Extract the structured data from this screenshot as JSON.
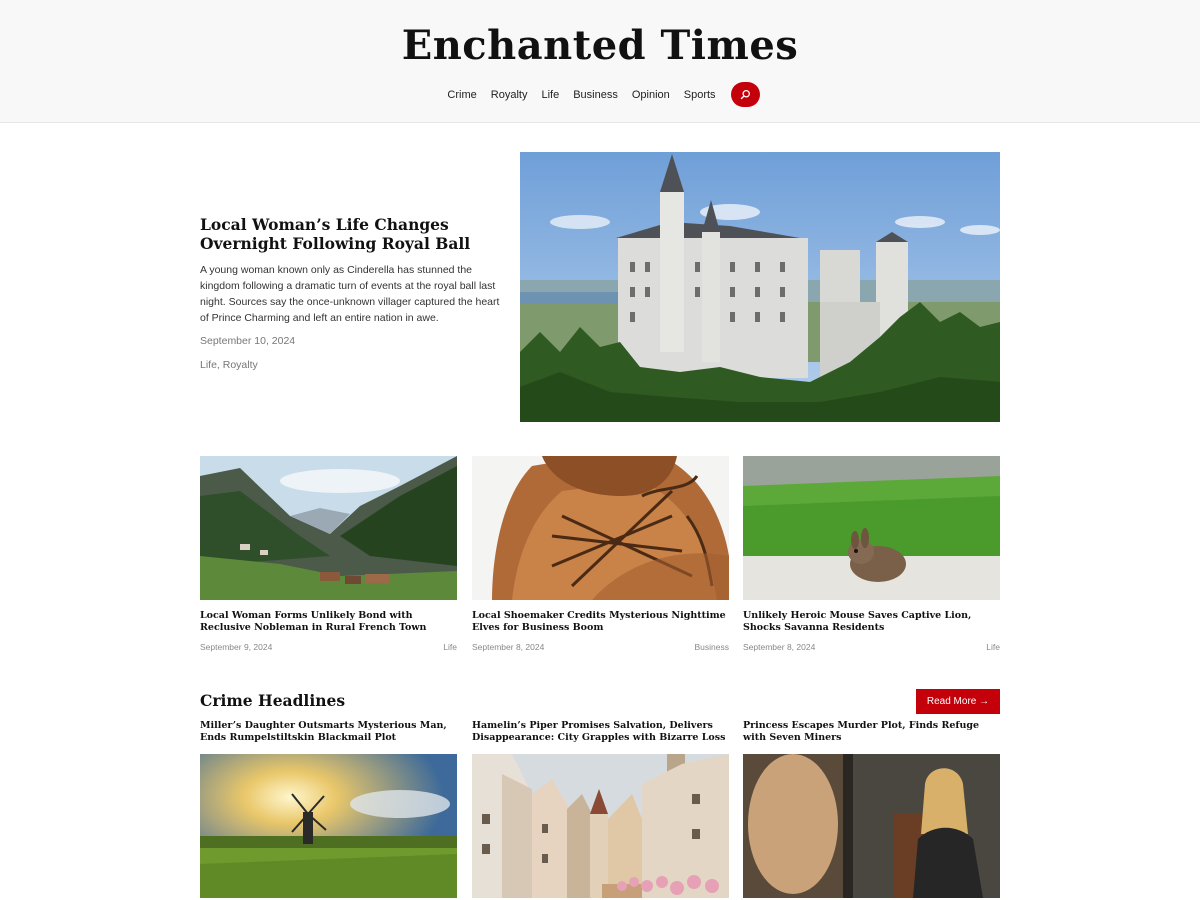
{
  "site": {
    "title": "Enchanted Times"
  },
  "nav": {
    "items": [
      "Crime",
      "Royalty",
      "Life",
      "Business",
      "Opinion",
      "Sports"
    ],
    "search_icon": "search-icon"
  },
  "hero": {
    "title": "Local Woman’s Life Changes Overnight Following Royal Ball",
    "excerpt": "A young woman known only as Cinderella has stunned the kingdom following a dramatic turn of events at the royal ball last night. Sources say the once-unknown villager captured the heart of Prince Charming and left an entire nation in awe.",
    "date": "September 10, 2024",
    "categories": "Life, Royalty"
  },
  "cards": [
    {
      "title": "Local Woman Forms Unlikely Bond with Reclusive Nobleman in Rural French Town",
      "date": "September 9, 2024",
      "category": "Life"
    },
    {
      "title": "Local Shoemaker Credits Mysterious Nighttime Elves for Business Boom",
      "date": "September 8, 2024",
      "category": "Business"
    },
    {
      "title": "Unlikely Heroic Mouse Saves Captive Lion, Shocks Savanna Residents",
      "date": "September 8, 2024",
      "category": "Life"
    }
  ],
  "crime": {
    "heading": "Crime Headlines",
    "read_more": "Read More →",
    "items": [
      {
        "title": "Miller’s Daughter Outsmarts Mysterious Man, Ends Rumpelstiltskin Blackmail Plot"
      },
      {
        "title": "Hamelin’s Piper Promises Salvation, Delivers Disappearance: City Grapples with Bizarre Loss"
      },
      {
        "title": "Princess Escapes Murder Plot, Finds Refuge with Seven Miners"
      }
    ]
  },
  "colors": {
    "accent": "#c4000a",
    "header_bg": "#f8f8f8"
  }
}
